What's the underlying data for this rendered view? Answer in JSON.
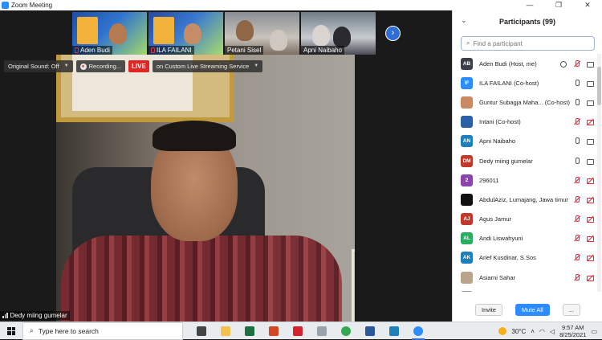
{
  "window": {
    "title": "Zoom Meeting",
    "controls": [
      "—",
      "❐",
      "✕"
    ]
  },
  "thumbnails": [
    {
      "name": "Aden Budi",
      "muted": true
    },
    {
      "name": "ILA FAILANI",
      "muted": true
    },
    {
      "name": "Petani Sisel",
      "muted": false
    },
    {
      "name": "Apni Naibaho",
      "muted": false
    }
  ],
  "next_page": "›",
  "recbar": {
    "sound": "Original Sound: Off",
    "recording": "Recording...",
    "live": "LIVE",
    "streaming": "on Custom Live Streaming Service"
  },
  "active_speaker": "Dedy miing gumelar",
  "participants_panel": {
    "title": "Participants (99)",
    "search_placeholder": "Find a participant",
    "invite": "Invite",
    "mute_all": "Mute All",
    "more": "..."
  },
  "participants": [
    {
      "initials": "AB",
      "color": "#3a3f4a",
      "name": "Aden Budi (Host, me)",
      "mic": "off",
      "cam": "on",
      "share": true
    },
    {
      "initials": "IF",
      "color": "#2d8cff",
      "name": "ILA FAILANI (Co-host)",
      "mic": "on",
      "cam": "on"
    },
    {
      "initials": "",
      "color": "#c98a63",
      "name": "Guntur Subagja Maha... (Co-host)",
      "mic": "on",
      "cam": "on"
    },
    {
      "initials": "",
      "color": "#2b5fa6",
      "name": "Intani (Co-host)",
      "mic": "off",
      "cam": "off"
    },
    {
      "initials": "AN",
      "color": "#1f7fb8",
      "name": "Apni Naibaho",
      "mic": "on",
      "cam": "on"
    },
    {
      "initials": "DM",
      "color": "#c0392b",
      "name": "Dedy miing gumelar",
      "mic": "on",
      "cam": "on"
    },
    {
      "initials": "2",
      "color": "#8e44ad",
      "name": "296011",
      "mic": "off",
      "cam": "off"
    },
    {
      "initials": "",
      "color": "#111111",
      "name": "AbdulAziz, Lumajang, Jawa timur",
      "mic": "off",
      "cam": "off"
    },
    {
      "initials": "AJ",
      "color": "#c0392b",
      "name": "Agus Jamur",
      "mic": "off",
      "cam": "off"
    },
    {
      "initials": "AL",
      "color": "#27ae60",
      "name": "Andi Liswahyuni",
      "mic": "off",
      "cam": "off"
    },
    {
      "initials": "AK",
      "color": "#1f7fb8",
      "name": "Arief Kusdinar, S.Sos",
      "mic": "off",
      "cam": "off"
    },
    {
      "initials": "",
      "color": "#b9a48a",
      "name": "Asiarni Sahar",
      "mic": "off",
      "cam": "off"
    },
    {
      "initials": "",
      "color": "#999999",
      "name": "A...",
      "mic": "off",
      "cam": "off"
    }
  ],
  "taskbar": {
    "search_placeholder": "Type here to search",
    "weather": "30°C",
    "time": "9:57 AM",
    "date": "8/25/2021",
    "apps": [
      {
        "name": "task-view",
        "color": "#444444"
      },
      {
        "name": "file-explorer",
        "color": "#f2c14e"
      },
      {
        "name": "excel",
        "color": "#1d6f42"
      },
      {
        "name": "powerpoint",
        "color": "#d24726"
      },
      {
        "name": "acrobat",
        "color": "#d4242b"
      },
      {
        "name": "app-gray",
        "color": "#9aa3ab"
      },
      {
        "name": "chrome",
        "color": "#34a853"
      },
      {
        "name": "word",
        "color": "#2b579a"
      },
      {
        "name": "photos",
        "color": "#1f7fb8"
      },
      {
        "name": "zoom",
        "color": "#2d8cff"
      }
    ]
  }
}
